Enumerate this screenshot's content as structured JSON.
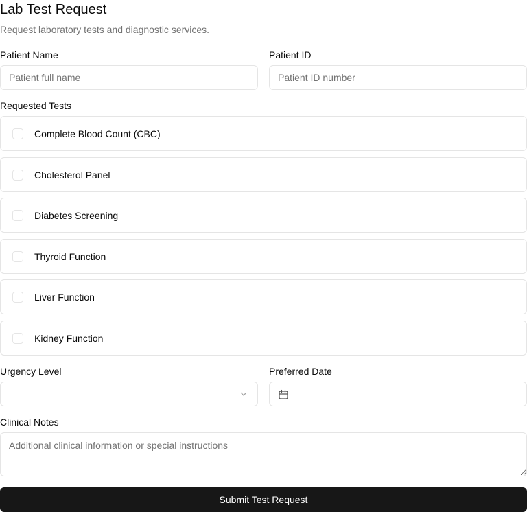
{
  "form": {
    "title": "Lab Test Request",
    "subtitle": "Request laboratory tests and diagnostic services."
  },
  "patient_name": {
    "label": "Patient Name",
    "placeholder": "Patient full name",
    "value": ""
  },
  "patient_id": {
    "label": "Patient ID",
    "placeholder": "Patient ID number",
    "value": ""
  },
  "requested_tests": {
    "label": "Requested Tests",
    "items": [
      {
        "label": "Complete Blood Count (CBC)",
        "checked": false
      },
      {
        "label": "Cholesterol Panel",
        "checked": false
      },
      {
        "label": "Diabetes Screening",
        "checked": false
      },
      {
        "label": "Thyroid Function",
        "checked": false
      },
      {
        "label": "Liver Function",
        "checked": false
      },
      {
        "label": "Kidney Function",
        "checked": false
      }
    ]
  },
  "urgency": {
    "label": "Urgency Level",
    "value": "",
    "icon": "chevron-down-icon"
  },
  "preferred_date": {
    "label": "Preferred Date",
    "value": "",
    "icon": "calendar-icon"
  },
  "clinical_notes": {
    "label": "Clinical Notes",
    "placeholder": "Additional clinical information or special instructions",
    "value": ""
  },
  "submit": {
    "label": "Submit Test Request"
  },
  "colors": {
    "primary": "#171717",
    "border": "#e5e5e5",
    "muted_text": "#737373"
  }
}
